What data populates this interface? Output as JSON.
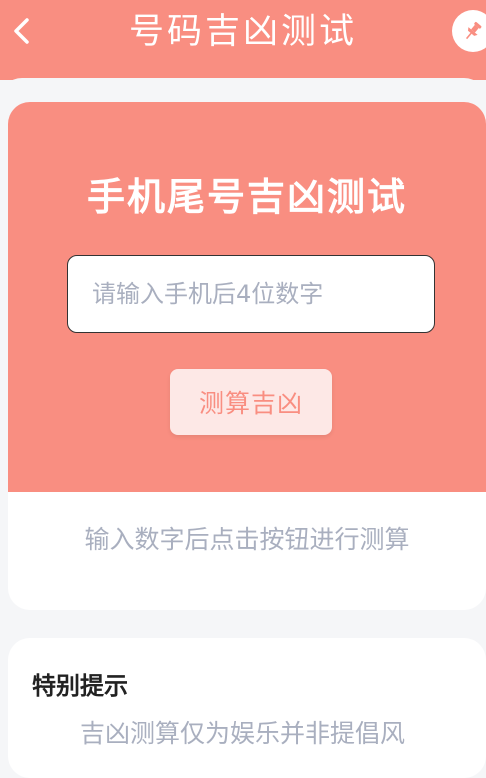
{
  "header": {
    "title": "号码吉凶测试",
    "back_icon": "chevron-left-icon",
    "pin_icon": "pin-icon"
  },
  "main": {
    "card_title": "手机尾号吉凶测试",
    "input_placeholder": "请输入手机后4位数字",
    "input_value": "",
    "calc_button": "测算吉凶",
    "hint": "输入数字后点击按钮进行测算"
  },
  "notice": {
    "title": "特别提示",
    "text": "吉凶测算仅为娱乐并非提倡风"
  },
  "colors": {
    "brand": "#f98e81",
    "button_bg": "#fde8e6",
    "muted_text": "#a9afbf",
    "page_bg": "#f5f6f8"
  }
}
